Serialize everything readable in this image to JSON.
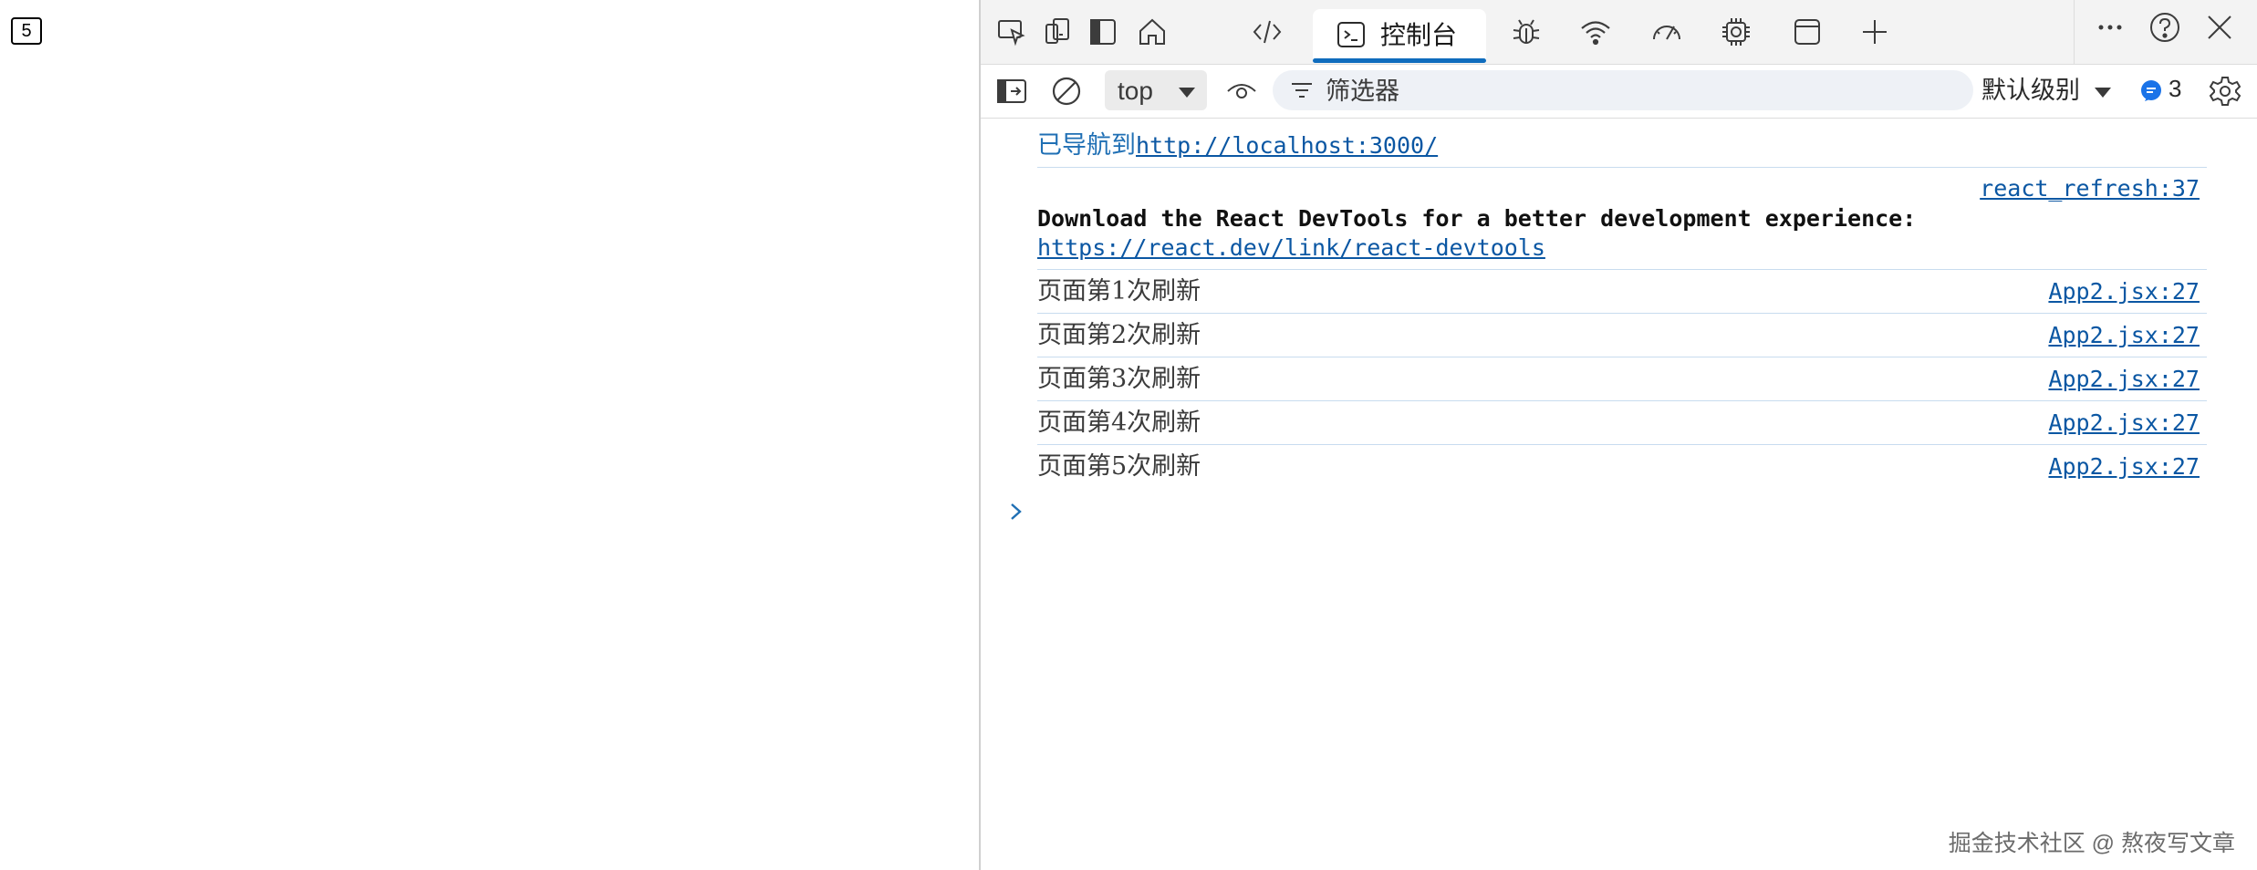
{
  "page": {
    "counter": "5"
  },
  "devtools": {
    "tabs": {
      "console_label": "控制台"
    },
    "toolbar": {
      "context": "top",
      "filter_placeholder": "筛选器",
      "levels": "默认级别",
      "issues_count": "3"
    },
    "icons": {
      "tabbar": [
        "inspect-icon",
        "device-emulation-icon",
        "dock-icon",
        "home-icon",
        "sources-icon",
        "console-icon",
        "bug-icon",
        "network-icon",
        "performance-icon",
        "memory-icon",
        "application-icon",
        "add-tab-icon",
        "more-icon",
        "help-icon",
        "close-icon"
      ],
      "toolbar": [
        "sidebar-toggle-icon",
        "clear-console-icon",
        "caret-down-icon",
        "live-expression-icon",
        "filter-icon",
        "issues-icon",
        "settings-icon"
      ]
    },
    "accent_color": "#0f6cbd",
    "console": {
      "navigation": {
        "text": "已导航到",
        "url": "http://localhost:3000/"
      },
      "devtools_message": {
        "source": "react_refresh:37",
        "text": "Download the React DevTools for a better development experience:",
        "link": "https://react.dev/link/react-devtools"
      },
      "logs": [
        {
          "text": "页面第1次刷新",
          "source": "App2.jsx:27"
        },
        {
          "text": "页面第2次刷新",
          "source": "App2.jsx:27"
        },
        {
          "text": "页面第3次刷新",
          "source": "App2.jsx:27"
        },
        {
          "text": "页面第4次刷新",
          "source": "App2.jsx:27"
        },
        {
          "text": "页面第5次刷新",
          "source": "App2.jsx:27"
        }
      ]
    }
  },
  "watermark": "掘金技术社区 @ 熬夜写文章"
}
